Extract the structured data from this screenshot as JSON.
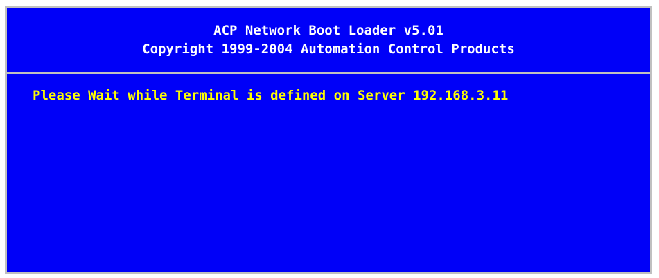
{
  "header": {
    "title": "ACP Network Boot Loader v5.01",
    "copyright": "Copyright 1999-2004 Automation Control Products"
  },
  "main": {
    "message": "Please Wait while Terminal is defined on Server 192.168.3.11"
  },
  "colors": {
    "background": "#0000f8",
    "border": "#c0c0c0",
    "header_text": "#ffffff",
    "message_text": "#ffff00"
  }
}
